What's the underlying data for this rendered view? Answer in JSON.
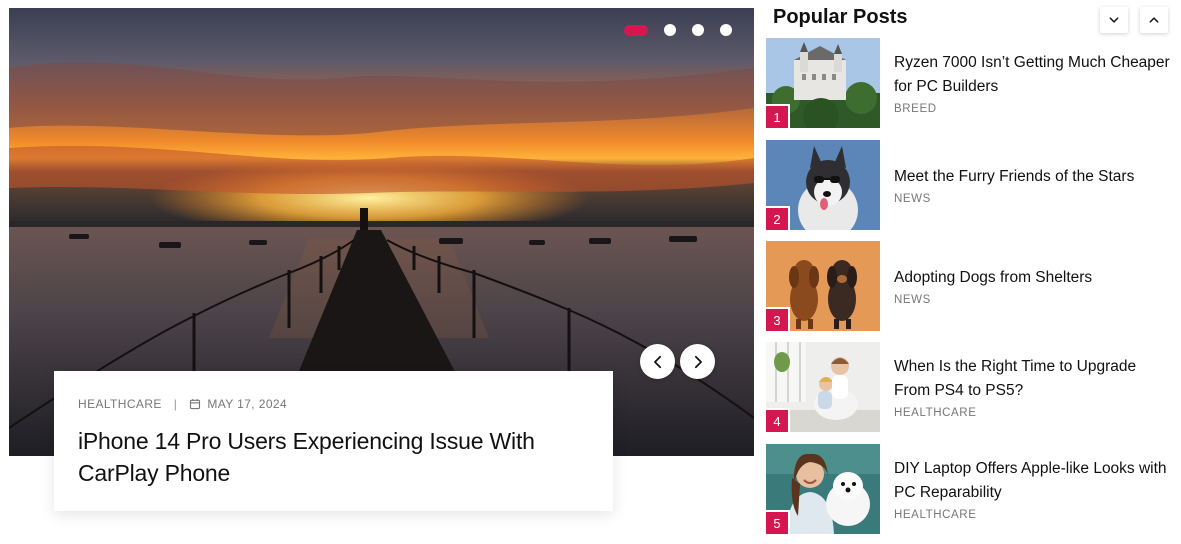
{
  "slider": {
    "dots": [
      {
        "active": true
      },
      {
        "active": false
      },
      {
        "active": false
      },
      {
        "active": false
      }
    ],
    "accent_color": "#d4184f",
    "prev_icon": "chevron-left-icon",
    "next_icon": "chevron-right-icon",
    "caption": {
      "category": "HEALTHCARE",
      "separator": "|",
      "date_icon": "calendar-icon",
      "date": "MAY 17, 2024",
      "title": "iPhone 14 Pro Users Experiencing Issue With CarPlay Phone"
    }
  },
  "popular": {
    "heading": "Popular Posts",
    "down_icon": "chevron-down-icon",
    "up_icon": "chevron-up-icon",
    "posts": [
      {
        "number": "1",
        "title": "Ryzen 7000 Isn’t Getting Much Cheaper for PC Builders",
        "category": "BREED"
      },
      {
        "number": "2",
        "title": "Meet the Furry Friends of the Stars",
        "category": "NEWS"
      },
      {
        "number": "3",
        "title": "Adopting Dogs from Shelters",
        "category": "NEWS"
      },
      {
        "number": "4",
        "title": "When Is the Right Time to Upgrade From PS4 to PS5?",
        "category": "HEALTHCARE"
      },
      {
        "number": "5",
        "title": "DIY Laptop Offers Apple-like Looks with PC Reparability",
        "category": "HEALTHCARE"
      }
    ]
  }
}
